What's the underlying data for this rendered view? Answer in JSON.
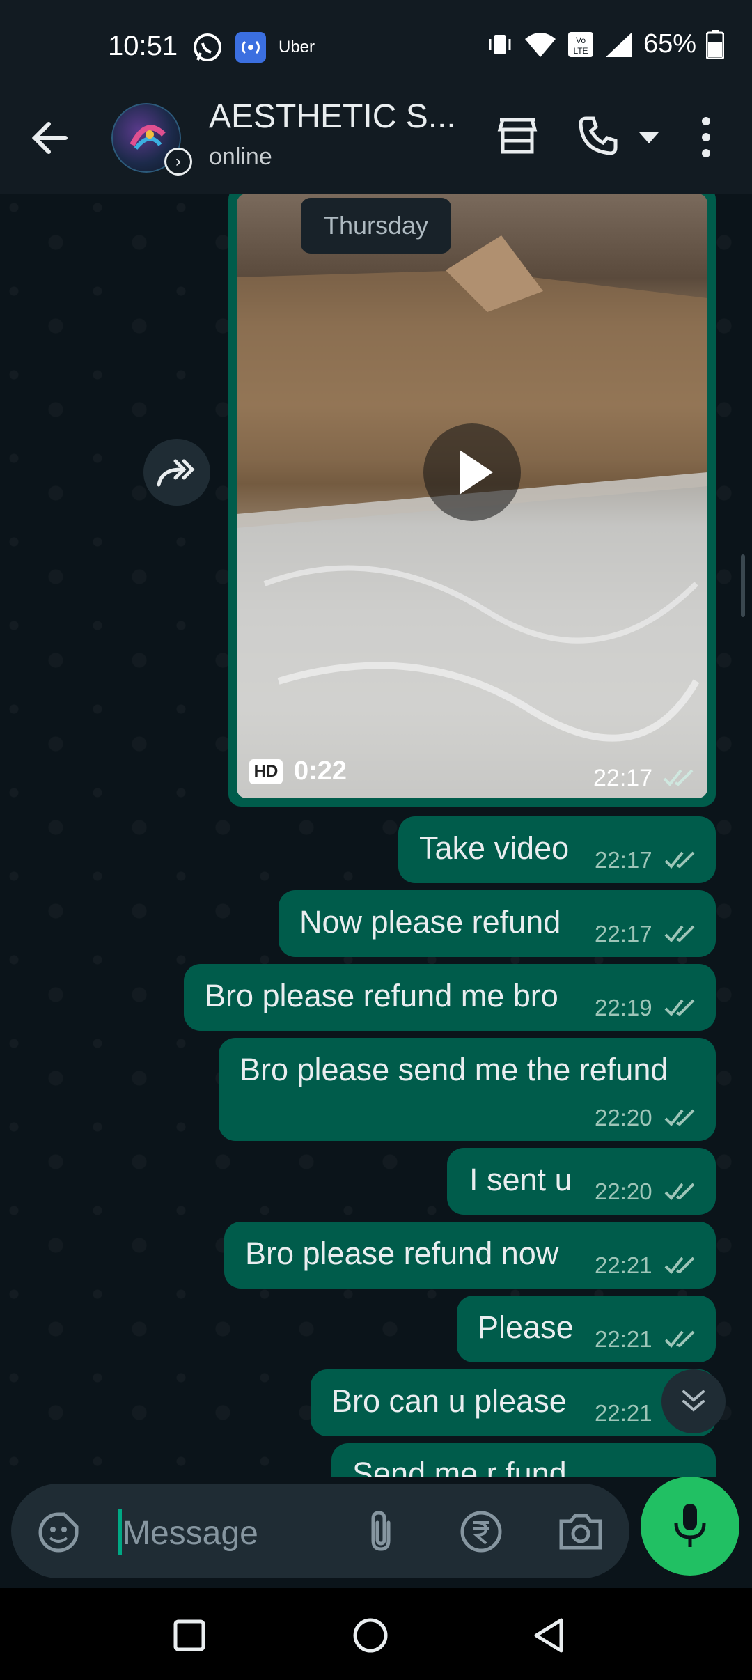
{
  "status_bar": {
    "time": "10:51",
    "notif_app_label": "Uber",
    "battery_percent": "65%",
    "icons": [
      "whatsapp-icon",
      "broadcast-icon",
      "uber-icon",
      "vibrate-icon",
      "wifi-icon",
      "volte-icon",
      "signal-icon",
      "battery-icon"
    ]
  },
  "header": {
    "title": "AESTHETIC S...",
    "subtitle": "online",
    "icons": [
      "back-arrow-icon",
      "store-icon",
      "phone-icon",
      "chevron-down-icon",
      "more-vert-icon"
    ]
  },
  "chat": {
    "date_separator": "Thursday",
    "video": {
      "badge": "HD",
      "duration": "0:22",
      "time": "22:17",
      "status": "read"
    },
    "messages": [
      {
        "text": "Take video",
        "time": "22:17",
        "status": "read"
      },
      {
        "text": "Now please refund",
        "time": "22:17",
        "status": "read"
      },
      {
        "text": "Bro please refund me bro",
        "time": "22:19",
        "status": "read"
      },
      {
        "text": "Bro please send me the refund",
        "time": "22:20",
        "status": "read"
      },
      {
        "text": "I sent u",
        "time": "22:20",
        "status": "read"
      },
      {
        "text": "Bro please refund now",
        "time": "22:21",
        "status": "read"
      },
      {
        "text": "Please",
        "time": "22:21",
        "status": "read"
      },
      {
        "text": "Bro can u please",
        "time": "22:21",
        "status": "read"
      },
      {
        "text": "Send me r fund",
        "time": "",
        "status": ""
      }
    ]
  },
  "composer": {
    "placeholder": "Message",
    "icons": [
      "emoji-sticker-icon",
      "attach-icon",
      "rupee-payment-icon",
      "camera-icon",
      "mic-icon"
    ]
  },
  "colors": {
    "outgoing_bubble": "#005c4b",
    "chat_background": "#0b141a",
    "header_background": "#121b22",
    "accent_green": "#21c063",
    "read_ticks": "#9ec5b8"
  }
}
